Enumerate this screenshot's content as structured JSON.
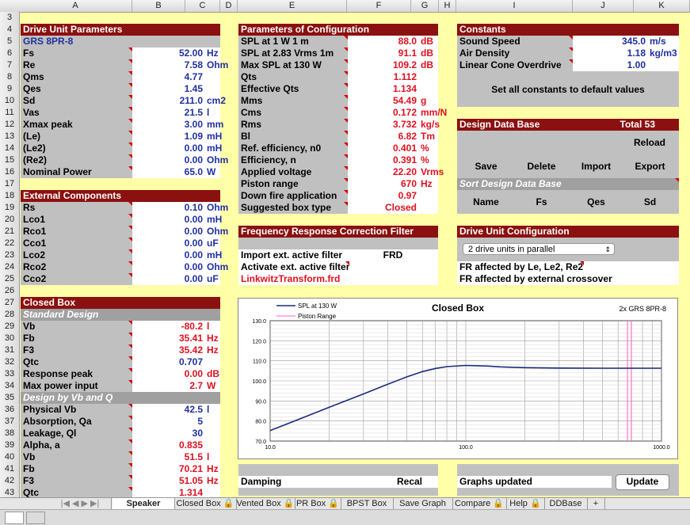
{
  "columns": [
    "A",
    "B",
    "C",
    "D",
    "E",
    "F",
    "G",
    "H",
    "I",
    "J",
    "K"
  ],
  "rows": [
    "3",
    "4",
    "5",
    "6",
    "7",
    "8",
    "9",
    "10",
    "11",
    "12",
    "13",
    "14",
    "15",
    "16",
    "17",
    "18",
    "19",
    "20",
    "21",
    "22",
    "23",
    "24",
    "25",
    "26",
    "27",
    "28",
    "29",
    "30",
    "31",
    "32",
    "33",
    "34",
    "35",
    "36",
    "37",
    "38",
    "39",
    "40",
    "41",
    "42",
    "43"
  ],
  "drive_unit": {
    "title": "Drive Unit Parameters",
    "model": "GRS 8PR-8",
    "params": [
      {
        "label": "Fs",
        "value": "52.00",
        "unit": "Hz"
      },
      {
        "label": "Re",
        "value": "7.58",
        "unit": "Ohm"
      },
      {
        "label": "Qms",
        "value": "4.77",
        "unit": ""
      },
      {
        "label": "Qes",
        "value": "1.45",
        "unit": ""
      },
      {
        "label": "Sd",
        "value": "211.0",
        "unit": "cm2"
      },
      {
        "label": "Vas",
        "value": "21.5",
        "unit": "l"
      },
      {
        "label": "Xmax peak",
        "value": "3.00",
        "unit": "mm"
      },
      {
        "label": "(Le)",
        "value": "1.09",
        "unit": "mH"
      },
      {
        "label": "(Le2)",
        "value": "0.00",
        "unit": "mH"
      },
      {
        "label": "(Re2)",
        "value": "0.00",
        "unit": "Ohm"
      },
      {
        "label": "Nominal Power",
        "value": "65.0",
        "unit": "W"
      }
    ]
  },
  "external": {
    "title": "External Components",
    "params": [
      {
        "label": "Rs",
        "value": "0.10",
        "unit": "Ohm"
      },
      {
        "label": "Lco1",
        "value": "0.00",
        "unit": "mH"
      },
      {
        "label": "Rco1",
        "value": "0.00",
        "unit": "Ohm"
      },
      {
        "label": "Cco1",
        "value": "0.00",
        "unit": "uF"
      },
      {
        "label": "Lco2",
        "value": "0.00",
        "unit": "mH"
      },
      {
        "label": "Rco2",
        "value": "0.00",
        "unit": "Ohm"
      },
      {
        "label": "Cco2",
        "value": "0.00",
        "unit": "uF"
      }
    ]
  },
  "closed_box": {
    "title": "Closed Box",
    "standard": "Standard Design",
    "std_params": [
      {
        "label": "Vb",
        "value": "-80.2",
        "unit": "l",
        "color": "red"
      },
      {
        "label": "Fb",
        "value": "35.41",
        "unit": "Hz",
        "color": "red"
      },
      {
        "label": "F3",
        "value": "35.42",
        "unit": "Hz",
        "color": "red"
      },
      {
        "label": "Qtc",
        "value": "0.707",
        "unit": "",
        "color": "blue"
      },
      {
        "label": "Response peak",
        "value": "0.00",
        "unit": "dB",
        "color": "red"
      },
      {
        "label": "Max power input",
        "value": "2.7",
        "unit": "W",
        "color": "red"
      }
    ],
    "vbq": "Design by Vb and Q",
    "vbq_params": [
      {
        "label": "Physical Vb",
        "value": "42.5",
        "unit": "l",
        "color": "blue"
      },
      {
        "label": "Absorption, Qa",
        "value": "5",
        "unit": "",
        "color": "blue"
      },
      {
        "label": "Leakage, Ql",
        "value": "30",
        "unit": "",
        "color": "blue"
      },
      {
        "label": "Alpha, a",
        "value": "0.835",
        "unit": "",
        "color": "red"
      },
      {
        "label": "Vb",
        "value": "51.5",
        "unit": "l",
        "color": "red"
      },
      {
        "label": "Fb",
        "value": "70.21",
        "unit": "Hz",
        "color": "red"
      },
      {
        "label": "F3",
        "value": "51.05",
        "unit": "Hz",
        "color": "red"
      },
      {
        "label": "Qtc",
        "value": "1.314",
        "unit": "",
        "color": "red"
      }
    ]
  },
  "config": {
    "title": "Parameters of Configuration",
    "params": [
      {
        "label": "SPL at 1 W 1 m",
        "value": "88.0",
        "unit": "dB"
      },
      {
        "label": "SPL at 2.83 Vrms 1m",
        "value": "91.1",
        "unit": "dB"
      },
      {
        "label": "Max SPL at 130 W",
        "value": "109.2",
        "unit": "dB"
      },
      {
        "label": "Qts",
        "value": "1.112",
        "unit": ""
      },
      {
        "label": "Effective Qts",
        "value": "1.134",
        "unit": ""
      },
      {
        "label": "Mms",
        "value": "54.49",
        "unit": "g"
      },
      {
        "label": "Cms",
        "value": "0.172",
        "unit": "mm/N"
      },
      {
        "label": "Rms",
        "value": "3.732",
        "unit": "kg/s"
      },
      {
        "label": "Bl",
        "value": "6.82",
        "unit": "Tm"
      },
      {
        "label": "Ref. efficiency, n0",
        "value": "0.401",
        "unit": "%"
      },
      {
        "label": "Efficiency, n",
        "value": "0.391",
        "unit": "%"
      },
      {
        "label": "Applied voltage",
        "value": "22.20",
        "unit": "Vrms"
      },
      {
        "label": "Piston range",
        "value": "670",
        "unit": "Hz"
      },
      {
        "label": "Down fire application",
        "value": "0.97",
        "unit": ""
      },
      {
        "label": "Suggested box type",
        "value": "Closed",
        "unit": ""
      }
    ]
  },
  "filter": {
    "title": "Frequency Response Correction Filter",
    "import_label": "Import ext. active filter",
    "import_value": "FRD",
    "activate_label": "Activate ext. active filter",
    "file": "LinkwitzTransform.frd"
  },
  "constants": {
    "title": "Constants",
    "params": [
      {
        "label": "Sound Speed",
        "value": "345.0",
        "unit": "m/s"
      },
      {
        "label": "Air Density",
        "value": "1.18",
        "unit": "kg/m3"
      },
      {
        "label": "Linear Cone Overdrive",
        "value": "1.00",
        "unit": ""
      }
    ],
    "reset": "Set all constants to default values"
  },
  "database": {
    "title": "Design Data Base",
    "total": "Total  53",
    "reload": "Reload",
    "save": "Save",
    "delete": "Delete",
    "import": "Import",
    "export": "Export",
    "sort": "Sort Design Data Base",
    "name": "Name",
    "fs": "Fs",
    "qes": "Qes",
    "sd": "Sd"
  },
  "drive_config": {
    "title": "Drive Unit Configuration",
    "select": "2 drive units in parallel",
    "fr_le": "FR affected by Le, Le2, Re2",
    "fr_ext": "FR affected by external crossover"
  },
  "bottom": {
    "damping": "Damping",
    "recal": "Recal",
    "graphs": "Graphs updated",
    "update": "Update"
  },
  "chart_data": {
    "type": "line",
    "title": "Closed Box",
    "subtitle": "2x GRS 8PR-8",
    "xscale": "log",
    "xlim": [
      10,
      1000
    ],
    "ylim": [
      70,
      130
    ],
    "xticks": [
      "10.0",
      "100.0",
      "1000.0"
    ],
    "yticks": [
      "70.0",
      "80.0",
      "90.0",
      "100.0",
      "110.0",
      "120.0",
      "130.0"
    ],
    "grid": true,
    "legend": "top-left",
    "series": [
      {
        "name": "SPL at 130 W",
        "color": "#1a2a80",
        "x": [
          10,
          15,
          20,
          30,
          40,
          50,
          60,
          70,
          80,
          100,
          130,
          150,
          200,
          300,
          500,
          700,
          1000
        ],
        "y": [
          75.2,
          82.0,
          86.8,
          93.5,
          98.4,
          102.0,
          104.6,
          106.2,
          107.1,
          107.7,
          107.4,
          107.0,
          106.6,
          106.4,
          106.3,
          106.3,
          106.3
        ]
      },
      {
        "name": "Piston Range",
        "color": "#ff60c0",
        "x": [
          670,
          670
        ],
        "y": [
          70,
          130
        ]
      }
    ]
  },
  "tabs": [
    "Speaker Design",
    "Closed Box",
    "Vented Box",
    "PR Box",
    "BPST Box",
    "Save Graph",
    "Compare",
    "Help",
    "DDBase",
    "+"
  ]
}
